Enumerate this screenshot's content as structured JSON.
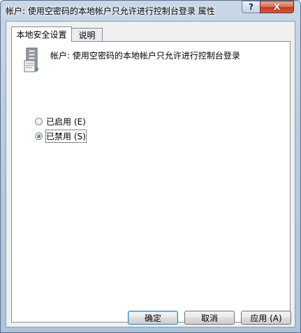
{
  "window": {
    "title": "帐户: 使用空密码的本地帐户只允许进行控制台登录 属性",
    "help_glyph": "?",
    "close_glyph": "X"
  },
  "tabs": [
    {
      "label": "本地安全设置",
      "active": true
    },
    {
      "label": "说明",
      "active": false
    }
  ],
  "policy": {
    "icon": "server-icon",
    "text": "帐户: 使用空密码的本地帐户只允许进行控制台登录"
  },
  "options": [
    {
      "label": "已启用 (E)",
      "checked": false
    },
    {
      "label": "已禁用 (S)",
      "checked": true
    }
  ],
  "buttons": {
    "ok": "确定",
    "cancel": "取消",
    "apply": "应用 (A)"
  }
}
